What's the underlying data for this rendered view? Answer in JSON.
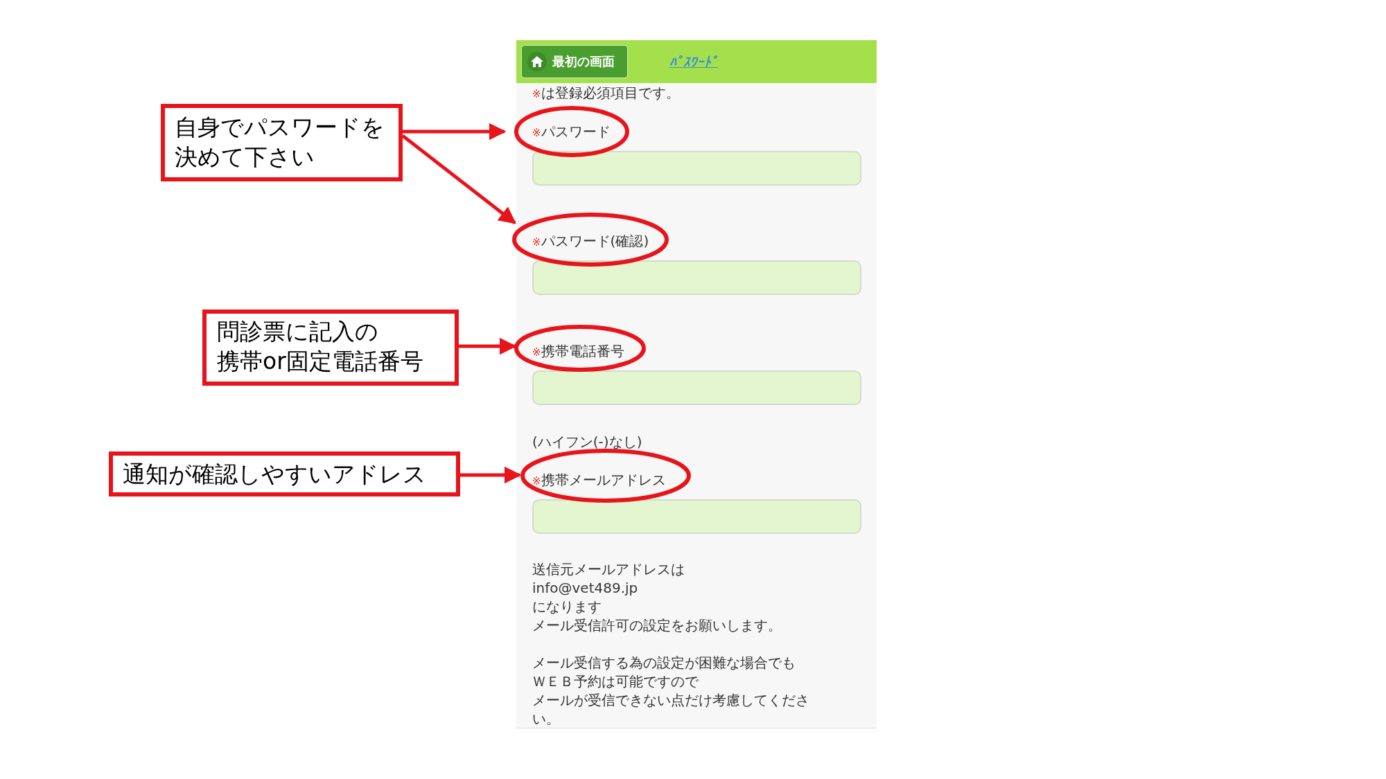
{
  "header": {
    "home_button": "最初の画面",
    "title_link": "ﾊﾟｽﾜｰﾄﾞ"
  },
  "required_note": {
    "mark": "※",
    "text": "は登録必須項目です。"
  },
  "fields": [
    {
      "mark": "※",
      "label": "パスワード",
      "highlighted": true
    },
    {
      "mark": "※",
      "label": "パスワード(確認)",
      "highlighted": true
    },
    {
      "mark": "※",
      "label": "携帯電話番号",
      "hint": "(ハイフン(-)なし)",
      "highlighted": true
    },
    {
      "mark": "※",
      "label": "携帯メールアドレス",
      "highlighted": true
    }
  ],
  "info_paragraphs": [
    [
      "送信元メールアドレスは",
      "info@vet489.jp",
      "になります",
      "メール受信許可の設定をお願いします。"
    ],
    [
      "メール受信する為の設定が困難な場合でも",
      "ＷＥＢ予約は可能ですので",
      "メールが受信できない点だけ考慮してくださ",
      "い。"
    ]
  ],
  "callouts": [
    {
      "lines": [
        "自身でパスワードを",
        "決めて下さい"
      ]
    },
    {
      "lines": [
        "問診票に記入の",
        "携帯or固定電話番号"
      ]
    },
    {
      "lines": [
        "通知が確認しやすいアドレス"
      ]
    }
  ]
}
